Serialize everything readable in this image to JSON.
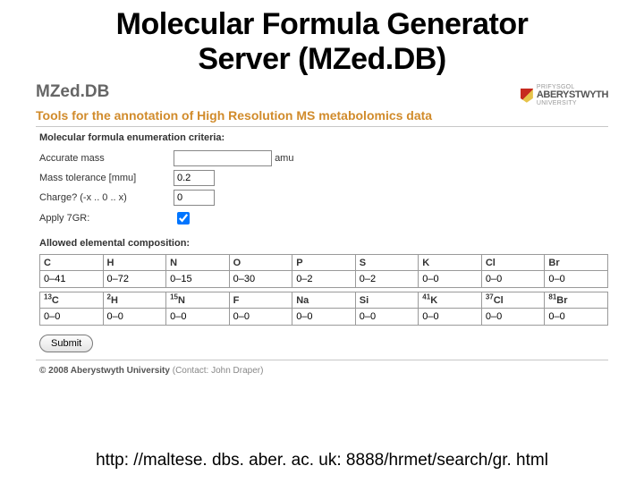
{
  "slide": {
    "title_line1": "Molecular Formula Generator",
    "title_line2": "Server (MZed.DB)"
  },
  "app": {
    "logo": "MZed.DB",
    "tagline": "Tools for the annotation of High Resolution MS metabolomics data",
    "uni": {
      "top": "PRIFYSGOL",
      "name": "ABERYSTWYTH",
      "bottom": "UNIVERSITY"
    }
  },
  "criteria": {
    "heading": "Molecular formula enumeration criteria:",
    "rows": {
      "accurate_mass": {
        "label": "Accurate mass",
        "value": "",
        "unit": "amu"
      },
      "mass_tolerance": {
        "label": "Mass tolerance [mmu]",
        "value": "0.2"
      },
      "charge": {
        "label": "Charge? (-x .. 0 .. x)",
        "value": "0"
      },
      "apply_7gr": {
        "label": "Apply 7GR:",
        "checked": true
      }
    }
  },
  "elements": {
    "heading": "Allowed elemental composition:",
    "row1": {
      "headers": [
        "C",
        "H",
        "N",
        "O",
        "P",
        "S",
        "K",
        "Cl",
        "Br"
      ],
      "values": [
        "0–41",
        "0–72",
        "0–15",
        "0–30",
        "0–2",
        "0–2",
        "0–0",
        "0–0",
        "0–0"
      ]
    },
    "row2": {
      "headers_html": [
        "<sup>13</sup>C",
        "<sup>2</sup>H",
        "<sup>15</sup>N",
        "F",
        "Na",
        "Si",
        "<sup>41</sup>K",
        "<sup>37</sup>Cl",
        "<sup>81</sup>Br"
      ],
      "values": [
        "0–0",
        "0–0",
        "0–0",
        "0–0",
        "0–0",
        "0–0",
        "0–0",
        "0–0",
        "0–0"
      ]
    }
  },
  "submit_label": "Submit",
  "footer": {
    "copyright": "© 2008 Aberystwyth University",
    "contact": "(Contact: John Draper)"
  },
  "url": "http: //maltese. dbs. aber. ac. uk: 8888/hrmet/search/gr. html"
}
